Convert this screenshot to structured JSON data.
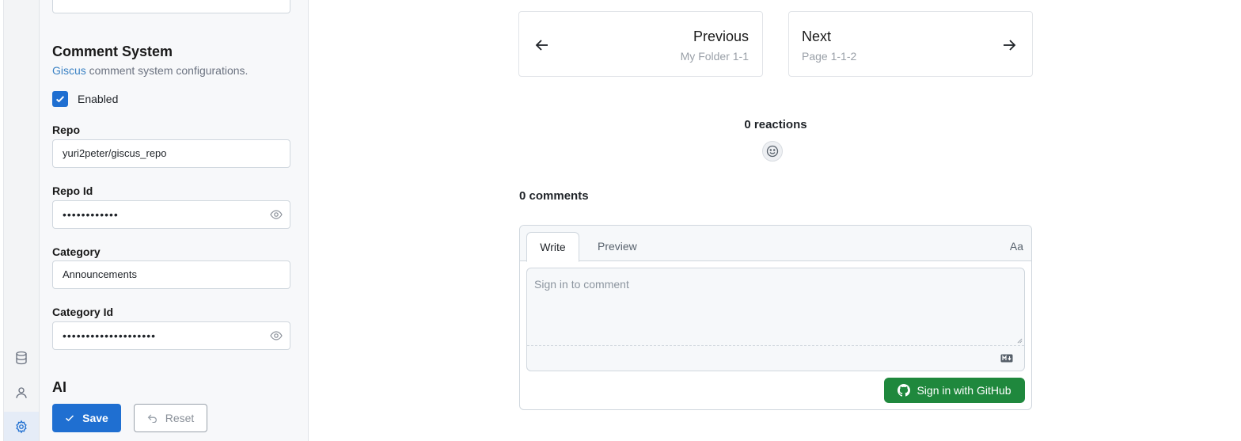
{
  "rail": {
    "items": [
      {
        "icon": "database-icon",
        "active": false
      },
      {
        "icon": "user-icon",
        "active": false
      },
      {
        "icon": "gear-icon",
        "active": true
      }
    ]
  },
  "settings": {
    "comment_system": {
      "title": "Comment System",
      "desc_link": "Giscus",
      "desc_rest": " comment system configurations.",
      "enabled_label": "Enabled",
      "enabled": true,
      "fields": [
        {
          "label": "Repo",
          "value": "yuri2peter/giscus_repo",
          "masked": false
        },
        {
          "label": "Repo Id",
          "value": "••••••••••••",
          "masked": true
        },
        {
          "label": "Category",
          "value": "Announcements",
          "masked": false
        },
        {
          "label": "Category Id",
          "value": "••••••••••••••••••••",
          "masked": true
        }
      ]
    },
    "ai": {
      "title": "AI"
    },
    "save_label": "Save",
    "reset_label": "Reset"
  },
  "pager": {
    "prev": {
      "label": "Previous",
      "sub": "My Folder 1-1"
    },
    "next": {
      "label": "Next",
      "sub": "Page 1-1-2"
    }
  },
  "giscus": {
    "reactions": "0 reactions",
    "comments": "0 comments",
    "tab_write": "Write",
    "tab_preview": "Preview",
    "font_toggle": "Aa",
    "placeholder": "Sign in to comment",
    "signin_label": "Sign in with GitHub",
    "signin_color": "#1f883d"
  },
  "colors": {
    "accent": "#1f6fd1",
    "link": "#3b82c4"
  }
}
